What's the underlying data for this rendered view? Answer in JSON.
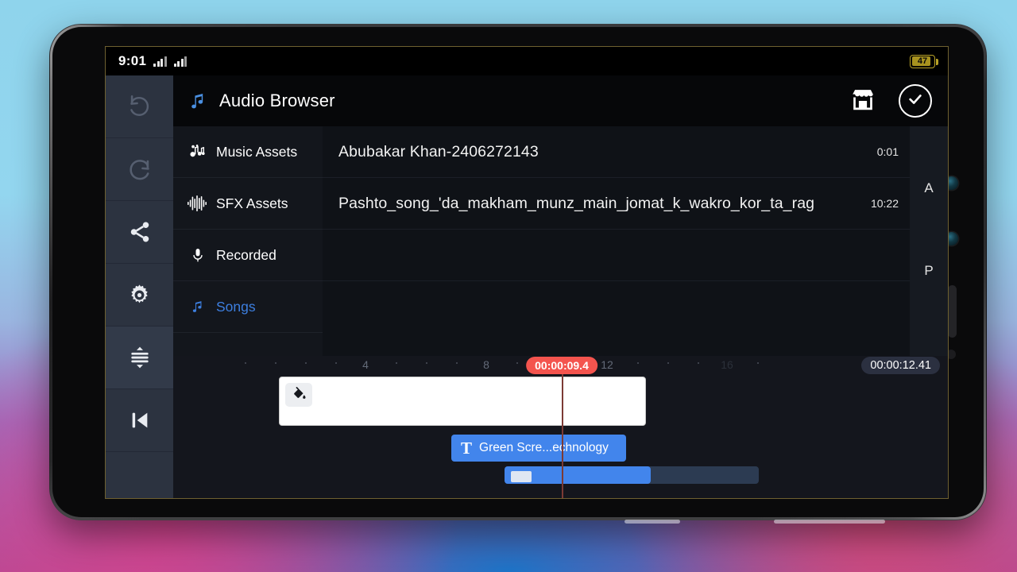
{
  "status_bar": {
    "time": "9:01",
    "battery_level": "47",
    "signal_icon": "signal-bars-icon"
  },
  "left_toolbar": [
    {
      "name": "undo",
      "icon": "undo-icon",
      "enabled": false
    },
    {
      "name": "redo",
      "icon": "redo-icon",
      "enabled": false
    },
    {
      "name": "share",
      "icon": "share-icon",
      "enabled": true
    },
    {
      "name": "settings",
      "icon": "gear-icon",
      "enabled": true
    },
    {
      "name": "expand-tracks",
      "icon": "expand-tracks-icon",
      "enabled": true
    },
    {
      "name": "skip-to-start",
      "icon": "skip-to-start-icon",
      "enabled": true
    }
  ],
  "header": {
    "title": "Audio Browser",
    "title_icon": "music-note-icon",
    "store_icon": "store-icon",
    "confirm_icon": "check-circle-icon"
  },
  "browser": {
    "nav_items": [
      {
        "label": "Music Assets",
        "icon": "music-assets-icon",
        "active": false
      },
      {
        "label": "SFX Assets",
        "icon": "waveform-icon",
        "active": false
      },
      {
        "label": "Recorded",
        "icon": "microphone-icon",
        "active": false
      },
      {
        "label": "Songs",
        "icon": "music-note-icon",
        "active": true
      }
    ],
    "tracks": [
      {
        "name": "Abubakar Khan-2406272143",
        "duration": "0:01"
      },
      {
        "name": "Pashto_song_'da_makham_munz_main_jomat_k_wakro_kor_ta_rag",
        "duration": "10:22"
      }
    ],
    "alpha_index": [
      "A",
      "P"
    ]
  },
  "timeline": {
    "ruler_labels": [
      "4",
      "8",
      "12",
      "16"
    ],
    "playhead_time": "00:00:09.4",
    "total_time": "00:00:12.41",
    "clips": {
      "fill_icon": "paint-bucket-icon",
      "text_clip_icon": "text-T-icon",
      "text_clip_label": "Green Scre...echnology"
    }
  },
  "colors": {
    "accent_blue": "#4285ec",
    "playhead_red": "#f4544e",
    "active_nav": "#3d7fe0",
    "battery_yellow": "#b9a227"
  }
}
